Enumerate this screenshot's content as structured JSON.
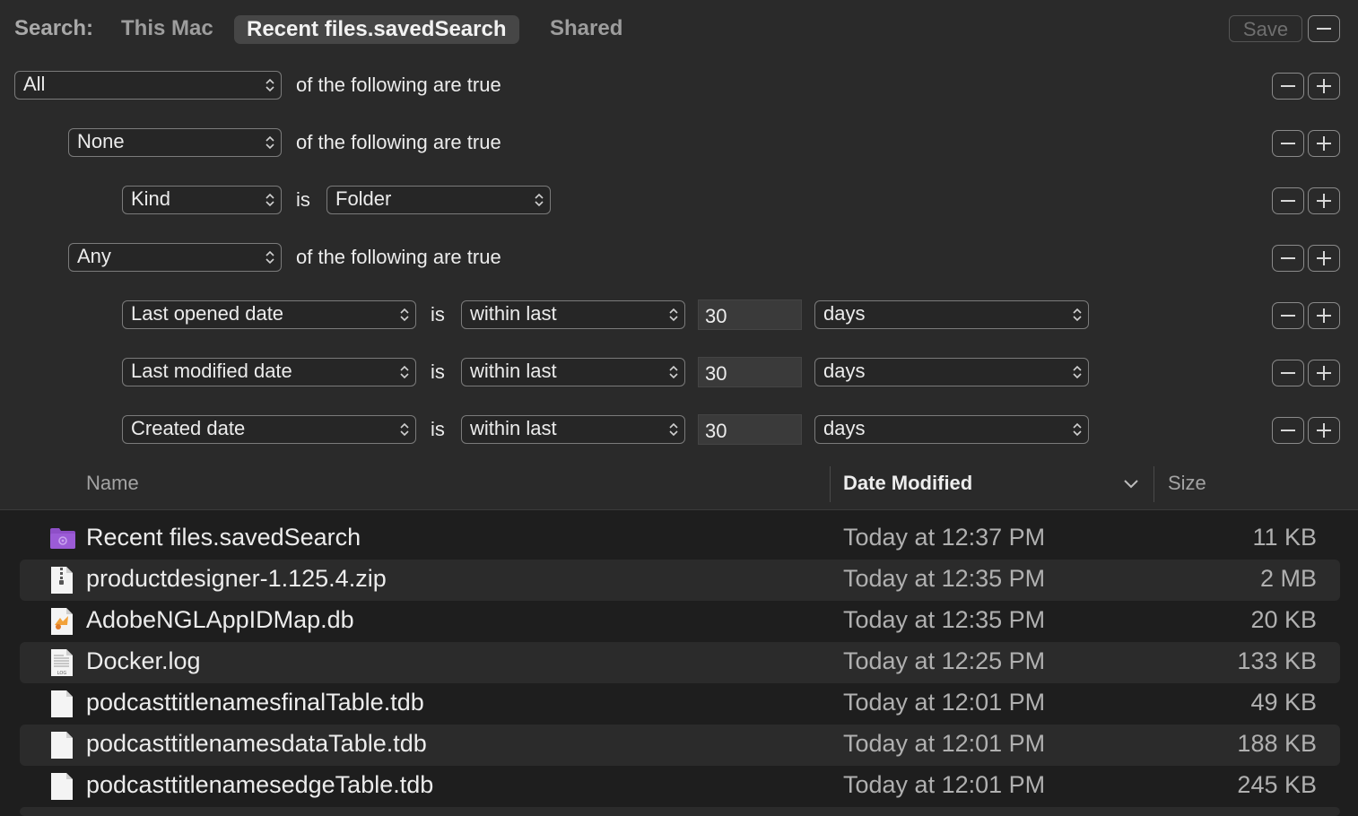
{
  "scope": {
    "label": "Search:",
    "tabs": [
      {
        "label": "This Mac",
        "active": false
      },
      {
        "label": "Recent files.savedSearch",
        "active": true
      },
      {
        "label": "Shared",
        "active": false
      }
    ],
    "save_label": "Save"
  },
  "criteria": [
    {
      "popup1": "All",
      "text": "of the following are true"
    },
    {
      "popup1": "None",
      "text": "of the following are true"
    },
    {
      "popup1": "Kind",
      "is": "is",
      "popup2": "Folder"
    },
    {
      "popup1": "Any",
      "text": "of the following are true"
    },
    {
      "popup1": "Last opened date",
      "is": "is",
      "popup2": "within last",
      "value": "30",
      "popup3": "days"
    },
    {
      "popup1": "Last modified date",
      "is": "is",
      "popup2": "within last",
      "value": "30",
      "popup3": "days"
    },
    {
      "popup1": "Created date",
      "is": "is",
      "popup2": "within last",
      "value": "30",
      "popup3": "days"
    }
  ],
  "columns": {
    "name": "Name",
    "date_modified": "Date Modified",
    "size": "Size"
  },
  "files": [
    {
      "name": "Recent files.savedSearch",
      "date": "Today at 12:37 PM",
      "size": "11 KB",
      "icon": "smart-folder-icon"
    },
    {
      "name": "productdesigner-1.125.4.zip",
      "date": "Today at 12:35 PM",
      "size": "2 MB",
      "icon": "zip-file-icon"
    },
    {
      "name": "AdobeNGLAppIDMap.db",
      "date": "Today at 12:35 PM",
      "size": "20 KB",
      "icon": "db-file-icon"
    },
    {
      "name": "Docker.log",
      "date": "Today at 12:25 PM",
      "size": "133 KB",
      "icon": "log-file-icon"
    },
    {
      "name": "podcasttitlenamesfinalTable.tdb",
      "date": "Today at 12:01 PM",
      "size": "49 KB",
      "icon": "document-icon"
    },
    {
      "name": "podcasttitlenamesdataTable.tdb",
      "date": "Today at 12:01 PM",
      "size": "188 KB",
      "icon": "document-icon"
    },
    {
      "name": "podcasttitlenamesedgeTable.tdb",
      "date": "Today at 12:01 PM",
      "size": "245 KB",
      "icon": "document-icon"
    }
  ],
  "colors": {
    "accent_folder": "#8e4fc7",
    "background": "#1e1e1e",
    "panel": "#2a2a2a"
  },
  "log_icon_text": "LOG"
}
